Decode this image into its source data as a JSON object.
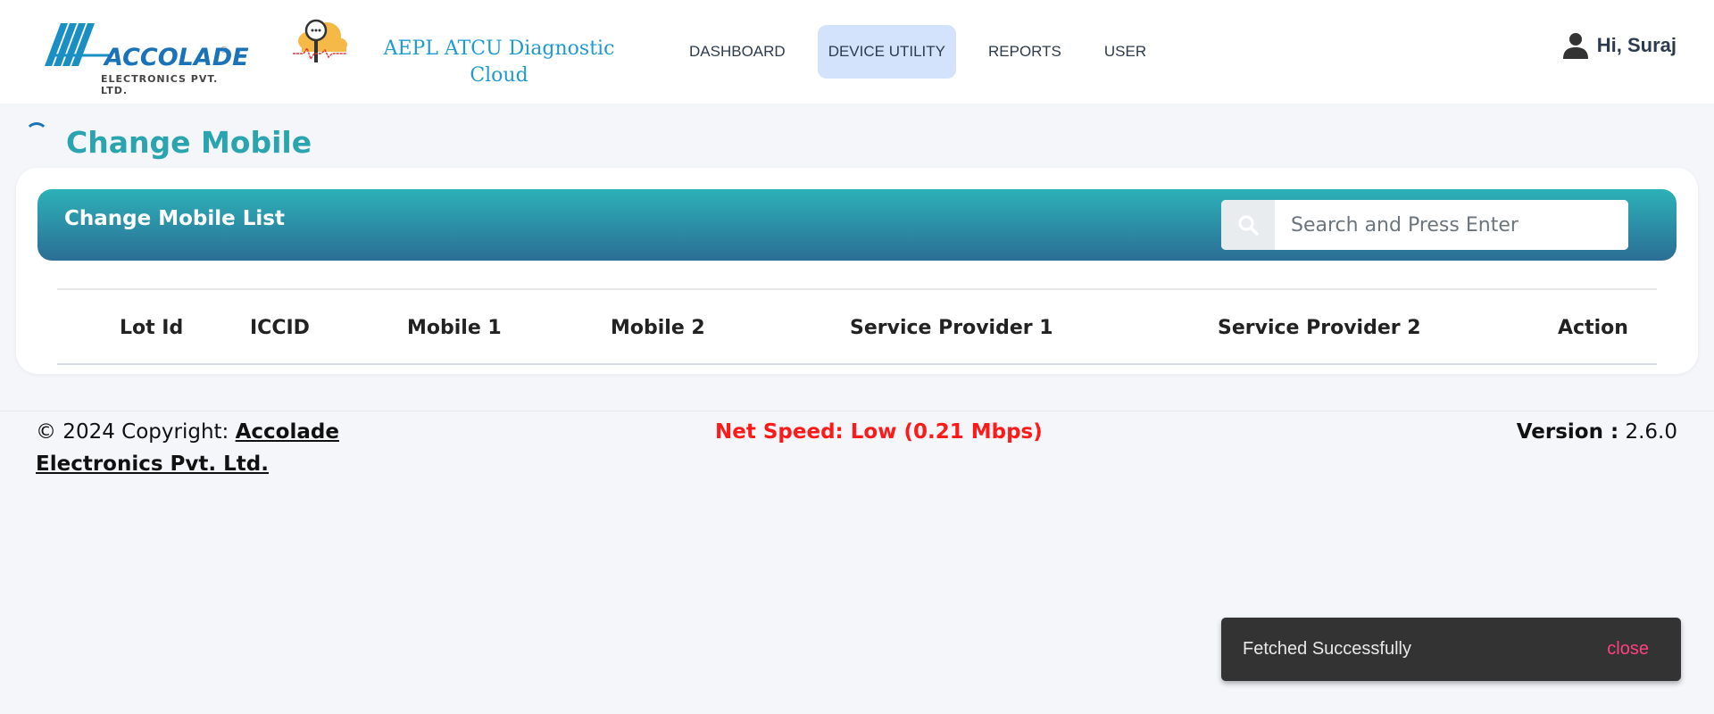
{
  "header": {
    "logo_text": "ACCOLADE",
    "logo_subtext": "ELECTRONICS PVT. LTD.",
    "app_title": "AEPL ATCU Diagnostic Cloud",
    "nav": [
      {
        "label": "DASHBOARD"
      },
      {
        "label": "DEVICE UTILITY",
        "active": true
      },
      {
        "label": "REPORTS"
      },
      {
        "label": "USER"
      }
    ],
    "user_greeting": "Hi, Suraj",
    "icons": {
      "user": "person-icon",
      "app": "cloud-magnifier-icon"
    }
  },
  "page": {
    "title": "Change Mobile"
  },
  "card": {
    "title": "Change Mobile List",
    "search": {
      "placeholder": "Search and Press Enter",
      "value": "",
      "icon": "search-icon"
    },
    "columns": [
      "Lot Id",
      "ICCID",
      "Mobile 1",
      "Mobile 2",
      "Service Provider 1",
      "Service Provider 2",
      "Action"
    ],
    "rows": []
  },
  "footer": {
    "copyright_prefix": "© 2024 Copyright: ",
    "company": "Accolade Electronics Pvt. Ltd.",
    "net_speed": "Net Speed: Low (0.21 Mbps)",
    "version_label": "Version :",
    "version_value": "2.6.0"
  },
  "toast": {
    "message": "Fetched Successfully",
    "action": "close"
  },
  "colors": {
    "accent_teal": "#2aa4ae",
    "header_gradient_top": "#2cb1b8",
    "header_gradient_bottom": "#2b6e95",
    "nav_active_bg": "#d2e3fb",
    "net_speed_red": "#ff1a1a",
    "toast_bg": "#333333",
    "toast_action": "#ff4081"
  }
}
